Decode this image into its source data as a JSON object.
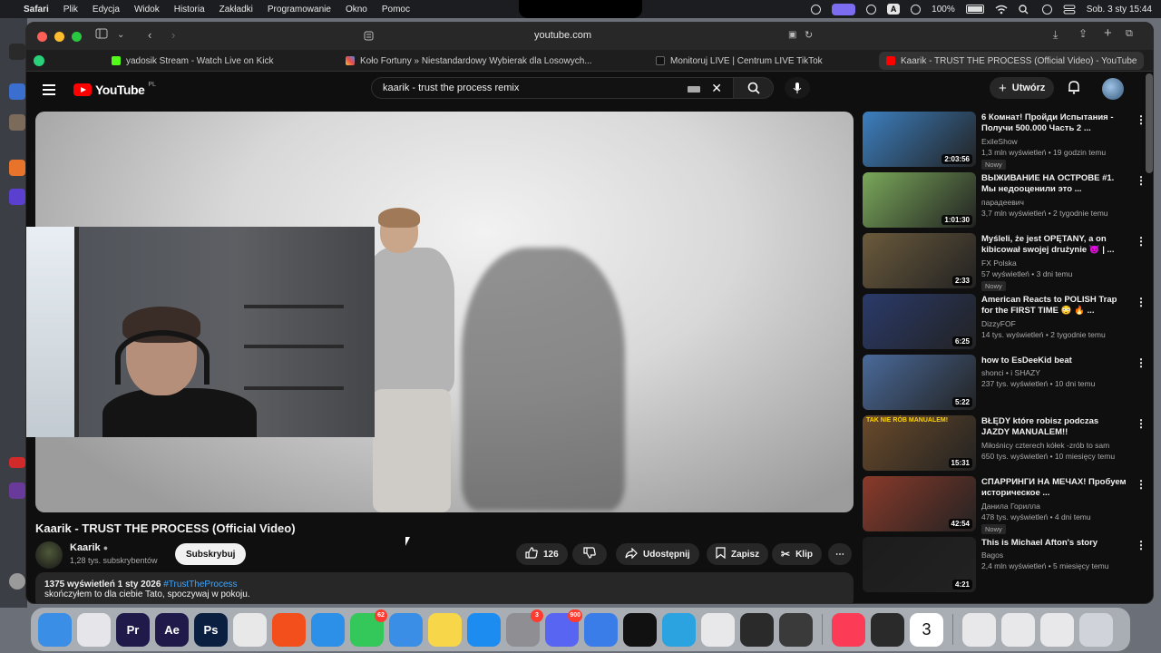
{
  "menubar": {
    "app": "Safari",
    "items": [
      "Plik",
      "Edycja",
      "Widok",
      "Historia",
      "Zakładki",
      "Programowanie",
      "Okno",
      "Pomoc"
    ],
    "battery": "100%",
    "clock": "Sob. 3 sty  15:44",
    "input_badge": "A"
  },
  "browser": {
    "url": "youtube.com",
    "tabs": [
      {
        "label": "yadosik Stream - Watch Live on Kick"
      },
      {
        "label": "Koło Fortuny » Niestandardowy Wybierak dla Losowych..."
      },
      {
        "label": "Monitoruj LIVE | Centrum LIVE TikTok"
      },
      {
        "label": "Kaarik - TRUST THE PROCESS (Official Video) - YouTube"
      }
    ]
  },
  "youtube": {
    "logo_text": "YouTube",
    "country_code": "PL",
    "search_value": "kaarik - trust the process remix",
    "create_label": "Utwórz"
  },
  "video": {
    "title": "Kaarik - TRUST THE PROCESS (Official Video)",
    "channel": "Kaarik",
    "subscribers": "1,28 tys. subskrybentów",
    "subscribe_label": "Subskrybuj",
    "likes": "126",
    "share_label": "Udostępnij",
    "save_label": "Zapisz",
    "clip_label": "Klip",
    "stats": "1375 wyświetleń  1 sty 2026",
    "hashtag": "#TrustTheProcess",
    "description": "skończyłem to dla ciebie Tato, spoczywaj w pokoju."
  },
  "recommendations": [
    {
      "title": "6 Комнат! Пройди Испытания - Получи 500.000 Часть 2 ...",
      "channel": "ExileShow",
      "meta": "1,3 mln wyświetleń • 19 godzin temu",
      "badge": "Nowy",
      "duration": "2:03:56",
      "thumb_color": "#3c7fbf"
    },
    {
      "title": "ВЫЖИВАНИЕ НА ОСТРОВЕ #1. Мы недооценили это ...",
      "channel": "парадеевич",
      "meta": "3,7 mln wyświetleń • 2 tygodnie temu",
      "badge": "",
      "duration": "1:01:30",
      "thumb_color": "#7aa85a"
    },
    {
      "title": "Myśleli, że jest OPĘTANY, a on kibicował swojej drużynie 😈 | ...",
      "channel": "FX Polska",
      "meta": "57 wyświetleń • 3 dni temu",
      "badge": "Nowy",
      "duration": "2:33",
      "thumb_color": "#6b5a3c"
    },
    {
      "title": "American Reacts to POLISH Trap for the FIRST TIME 😳 🔥 ...",
      "channel": "DizzyFOF",
      "meta": "14 tys. wyświetleń • 2 tygodnie temu",
      "badge": "",
      "duration": "6:25",
      "thumb_color": "#2a3a6a"
    },
    {
      "title": "how to EsDeeKid beat",
      "channel": "shonci • i SHAZY",
      "meta": "237 tys. wyświetleń • 10 dni temu",
      "badge": "",
      "duration": "5:22",
      "thumb_color": "#4a6a9a"
    },
    {
      "title": "BŁĘDY które robisz podczas JAZDY MANUALEM!!",
      "channel": "Miłośnicy czterech kółek -zrób to sam",
      "meta": "650 tys. wyświetleń • 10 miesięcy temu",
      "badge": "",
      "duration": "15:31",
      "thumb_color": "#6a4a2a",
      "thumb_text": "TAK NIE RÓB MANUALEM!"
    },
    {
      "title": "СПАРРИНГИ НА МЕЧАХ! Пробуем историческое ...",
      "channel": "Данила Горилла",
      "meta": "478 tys. wyświetleń • 4 dni temu",
      "badge": "Nowy",
      "duration": "42:54",
      "thumb_color": "#8a3a2a"
    },
    {
      "title": "This is Michael Afton's story",
      "channel": "Bagos",
      "meta": "2,4 mln wyświetleń • 5 miesięcy temu",
      "badge": "",
      "duration": "4:21",
      "thumb_color": "#1c1c1c"
    }
  ],
  "dock": [
    {
      "name": "finder",
      "color": "#3a8ee6",
      "label": ""
    },
    {
      "name": "launchpad",
      "color": "#e6e6ea",
      "label": ""
    },
    {
      "name": "premiere",
      "color": "#1f1a4a",
      "label": "Pr"
    },
    {
      "name": "after-effects",
      "color": "#1f1a4a",
      "label": "Ae"
    },
    {
      "name": "photoshop",
      "color": "#0b2040",
      "label": "Ps"
    },
    {
      "name": "blender",
      "color": "#e8e8e8",
      "label": ""
    },
    {
      "name": "brave",
      "color": "#f24f1c",
      "label": ""
    },
    {
      "name": "safari",
      "color": "#2c8fe8",
      "label": ""
    },
    {
      "name": "messages",
      "color": "#34c759",
      "label": "",
      "badge": "62"
    },
    {
      "name": "mail",
      "color": "#3a8ee6",
      "label": ""
    },
    {
      "name": "notes",
      "color": "#f7d64a",
      "label": ""
    },
    {
      "name": "app-store",
      "color": "#1c8cf0",
      "label": ""
    },
    {
      "name": "settings",
      "color": "#8e8e93",
      "label": "",
      "badge": "3"
    },
    {
      "name": "discord",
      "color": "#5865f2",
      "label": "",
      "badge": "900"
    },
    {
      "name": "roblox",
      "color": "#3b7de8",
      "label": ""
    },
    {
      "name": "spotify",
      "color": "#111111",
      "label": ""
    },
    {
      "name": "telegram",
      "color": "#2aa3e0",
      "label": ""
    },
    {
      "name": "slack",
      "color": "#e8e8ea",
      "label": ""
    },
    {
      "name": "fl-studio",
      "color": "#2a2a2a",
      "label": ""
    },
    {
      "name": "davinci",
      "color": "#3a3a3a",
      "label": ""
    },
    {
      "name": "music",
      "color": "#fc3c56",
      "label": ""
    },
    {
      "name": "whatsapp-like",
      "color": "#2a2a2a",
      "label": ""
    },
    {
      "name": "calendar",
      "color": "#ffffff",
      "label": "3"
    },
    {
      "name": "doc-1",
      "color": "#e8e8ea",
      "label": ""
    },
    {
      "name": "doc-2",
      "color": "#e8e8ea",
      "label": ""
    },
    {
      "name": "doc-3",
      "color": "#e8e8ea",
      "label": ""
    },
    {
      "name": "trash",
      "color": "#d0d4da",
      "label": ""
    }
  ]
}
